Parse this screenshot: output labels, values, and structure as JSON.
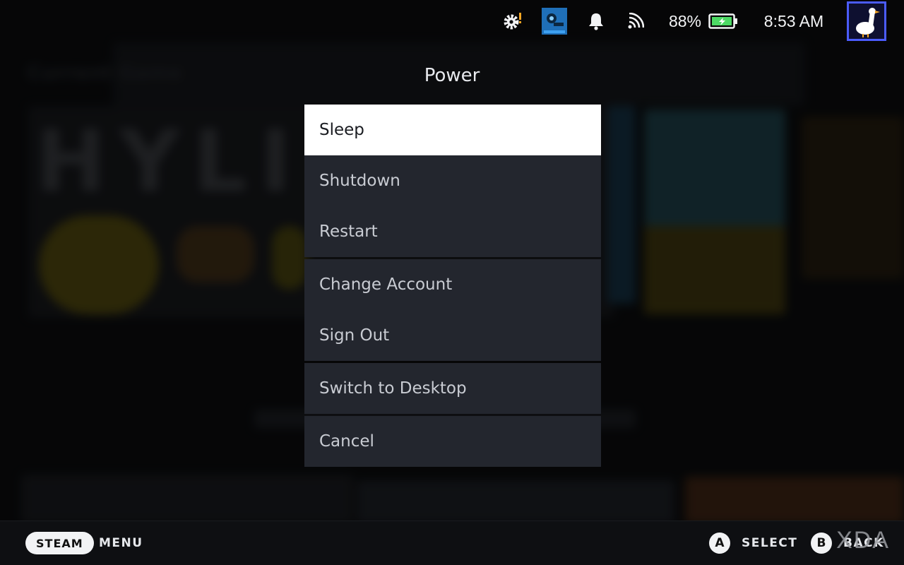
{
  "status_bar": {
    "icons": [
      "gear-alert-icon",
      "app-icon",
      "bell-icon",
      "wifi-icon",
      "battery-charging-icon",
      "avatar"
    ],
    "battery": "88%",
    "time": "8:53 AM"
  },
  "background": {
    "section_label": "Current Game",
    "hero_text": "HYLI"
  },
  "modal": {
    "title": "Power",
    "groups": [
      [
        "Sleep",
        "Shutdown",
        "Restart"
      ],
      [
        "Change Account",
        "Sign Out"
      ],
      [
        "Switch to Desktop"
      ],
      [
        "Cancel"
      ]
    ],
    "selected": "Sleep"
  },
  "bottom_bar": {
    "steam_label": "STEAM",
    "menu_label": "MENU",
    "a_glyph": "A",
    "select_label": "SELECT",
    "b_glyph": "B",
    "back_label": "BACK",
    "watermark": "XDA"
  },
  "colors": {
    "menu_bg": "#23262e",
    "selected_bg": "#ffffff",
    "accent_alert": "#f5a623",
    "battery_green": "#4cd964",
    "avatar_border": "#4b5cff"
  }
}
